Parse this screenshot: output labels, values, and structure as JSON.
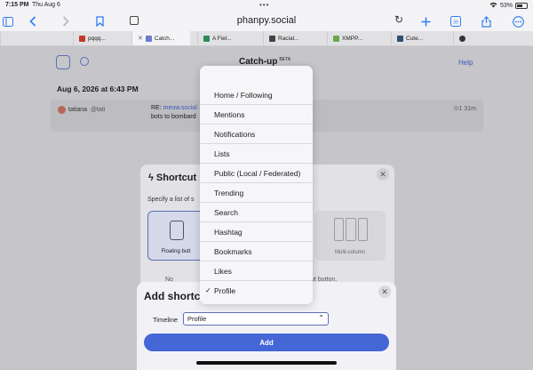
{
  "statusbar": {
    "time": "7:15 PM",
    "date": "Thu Aug 6",
    "battery": "53%"
  },
  "toolbar": {
    "url": "phanpy.social"
  },
  "tabs": [
    {
      "label": "pqqq...",
      "fav_color": "#c0392b"
    },
    {
      "label": "Catch...",
      "fav_color": "#6b7bd0"
    },
    {
      "label": "A Fiel...",
      "fav_color": "#2e8b57"
    },
    {
      "label": "Racial...",
      "fav_color": "#444444"
    },
    {
      "label": "XMPP...",
      "fav_color": "#6aa84f"
    },
    {
      "label": "Cute...",
      "fav_color": "#2f4f6f"
    },
    {
      "label": "",
      "fav_color": "#333333"
    }
  ],
  "page": {
    "title": "Catch-up",
    "beta": "BETA",
    "help": "Help",
    "date": "Aug 6, 2026 at 6:43 PM",
    "post": {
      "name": "tatiana",
      "handle": "@tati",
      "re_prefix": "RE:",
      "re_link": "meow.social",
      "line2": "bots to bombard",
      "meta": "1  31m"
    }
  },
  "shortcuts": {
    "title": "Shortcut",
    "desc": "Specify a list of s",
    "option1": "Floating butt",
    "option2": "Multi-column",
    "note_left": "No",
    "note_right": "ut button."
  },
  "add_sheet": {
    "title": "Add shortc",
    "timeline_label": "Timeline",
    "timeline_value": "Profile",
    "button": "Add"
  },
  "menu": {
    "items": [
      {
        "label": "Home / Following",
        "checked": false
      },
      {
        "label": "Mentions",
        "checked": false
      },
      {
        "label": "Notifications",
        "checked": false
      },
      {
        "label": "Lists",
        "checked": false
      },
      {
        "label": "Public (Local / Federated)",
        "checked": false
      },
      {
        "label": "Trending",
        "checked": false
      },
      {
        "label": "Search",
        "checked": false
      },
      {
        "label": "Hashtag",
        "checked": false
      },
      {
        "label": "Bookmarks",
        "checked": false
      },
      {
        "label": "Likes",
        "checked": false
      },
      {
        "label": "Profile",
        "checked": true
      }
    ],
    "check_glyph": "✓"
  }
}
